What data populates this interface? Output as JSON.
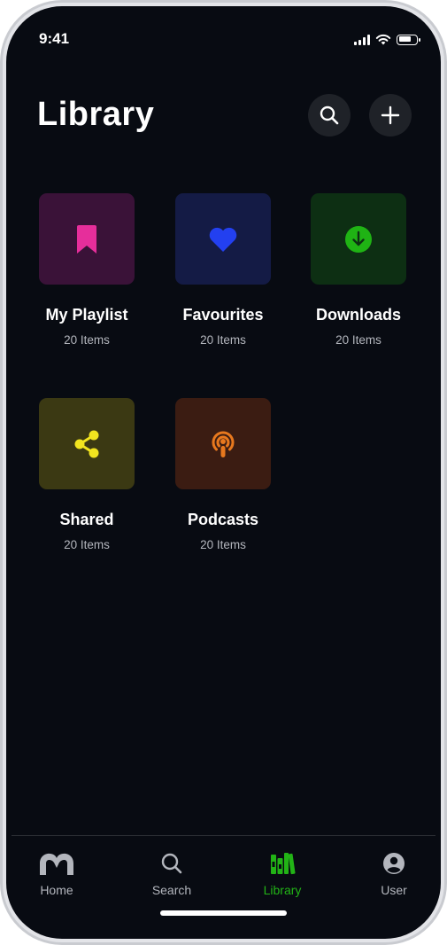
{
  "status": {
    "time": "9:41",
    "battery_level": 0.75
  },
  "header": {
    "title": "Library"
  },
  "tiles": [
    {
      "name": "My Playlist",
      "count": "20 Items",
      "icon": "bookmark-icon",
      "bg": "#3a1238",
      "fg": "#e62e9b"
    },
    {
      "name": "Favourites",
      "count": "20 Items",
      "icon": "heart-icon",
      "bg": "#141b45",
      "fg": "#2340f0"
    },
    {
      "name": "Downloads",
      "count": "20 Items",
      "icon": "download-icon",
      "bg": "#0d2f13",
      "fg": "#1fb314"
    },
    {
      "name": "Shared",
      "count": "20 Items",
      "icon": "share-icon",
      "bg": "#3b3913",
      "fg": "#f1e41f"
    },
    {
      "name": "Podcasts",
      "count": "20 Items",
      "icon": "podcast-icon",
      "bg": "#3b1c12",
      "fg": "#e7781e"
    }
  ],
  "tabbar": {
    "items": [
      {
        "label": "Home",
        "icon": "home-logo-icon"
      },
      {
        "label": "Search",
        "icon": "search-icon"
      },
      {
        "label": "Library",
        "icon": "library-icon",
        "active": true
      },
      {
        "label": "User",
        "icon": "user-icon"
      }
    ],
    "active_color": "#22b316",
    "inactive_color": "#b3b6bd"
  }
}
